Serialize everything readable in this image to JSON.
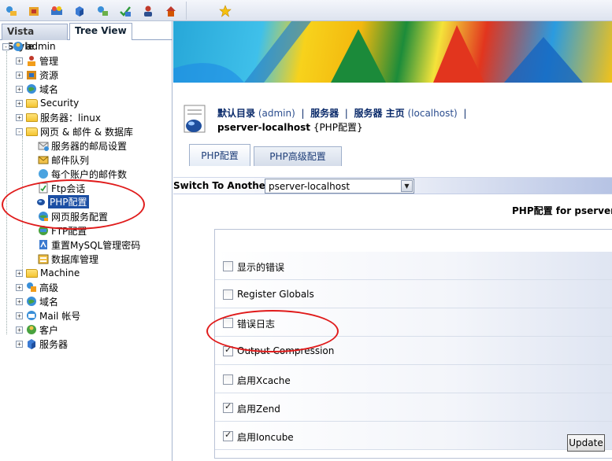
{
  "toolbar": {
    "icons": [
      "tools-icon",
      "resources-icon",
      "config-icon",
      "server-icon",
      "settings-icon",
      "check-icon",
      "user-icon",
      "home-icon",
      "favorite-star-icon"
    ]
  },
  "left_tabs": [
    {
      "label": "Vista Style",
      "active": false
    },
    {
      "label": "Tree View",
      "active": true
    }
  ],
  "tree": {
    "root": "admin",
    "items": [
      {
        "label": "管理",
        "icon": "admin-icon",
        "expander": "+"
      },
      {
        "label": "资源",
        "icon": "resource-icon",
        "expander": "+"
      },
      {
        "label": "域名",
        "icon": "globe-icon",
        "expander": "+"
      },
      {
        "label": "Security",
        "icon": "folder-icon",
        "expander": "+"
      },
      {
        "label": "服务器：linux",
        "icon": "folder-icon",
        "expander": "+"
      },
      {
        "label": "网页 & 邮件 & 数据库",
        "icon": "folder-icon",
        "expander": "-"
      },
      {
        "label": "服务器的邮局设置",
        "icon": "mail-server-icon",
        "expander": ""
      },
      {
        "label": "邮件队列",
        "icon": "mail-queue-icon",
        "expander": ""
      },
      {
        "label": "每个账户的邮件数",
        "icon": "mail-count-icon",
        "expander": ""
      },
      {
        "label": "Ftp会话",
        "icon": "ftp-session-icon",
        "expander": ""
      },
      {
        "label": "PHP配置",
        "icon": "php-icon",
        "expander": "",
        "selected": true
      },
      {
        "label": "网页服务配置",
        "icon": "web-config-icon",
        "expander": ""
      },
      {
        "label": "FTP配置",
        "icon": "ftp-config-icon",
        "expander": ""
      },
      {
        "label": "重置MySQL管理密码",
        "icon": "mysql-icon",
        "expander": ""
      },
      {
        "label": "数据库管理",
        "icon": "database-icon",
        "expander": ""
      },
      {
        "label": "Machine",
        "icon": "folder-icon",
        "expander": "+"
      },
      {
        "label": "高级",
        "icon": "advanced-icon",
        "expander": "+"
      },
      {
        "label": "域名",
        "icon": "globe-icon",
        "expander": "+"
      },
      {
        "label": "Mail 帐号",
        "icon": "mail-icon",
        "expander": "+"
      },
      {
        "label": "客户",
        "icon": "client-icon",
        "expander": "+"
      },
      {
        "label": "服务器",
        "icon": "server-icon",
        "expander": "+"
      }
    ]
  },
  "breadcrumb": {
    "part1": "默认目录",
    "part1_paren": "(admin)",
    "sep": "|",
    "part2": "服务器",
    "part3": "服务器 主页",
    "part3_paren": "(localhost)"
  },
  "page_title": {
    "bold": "pserver-localhost",
    "rest": " {PHP配置}"
  },
  "content_tabs": [
    {
      "label": "PHP配置",
      "active": true
    },
    {
      "label": "PHP高级配置",
      "active": false
    }
  ],
  "switch": {
    "label": "Switch To Another",
    "selected": "pserver-localhost"
  },
  "section_title": "PHP配置 for pserver-",
  "options": [
    {
      "label": "显示的错误",
      "checked": false
    },
    {
      "label": "Register Globals",
      "checked": false
    },
    {
      "label": "错误日志",
      "checked": false
    },
    {
      "label": "Output Compression",
      "checked": true
    },
    {
      "label": "启用Xcache",
      "checked": false
    },
    {
      "label": "启用Zend",
      "checked": true
    },
    {
      "label": "启用Ioncube",
      "checked": true
    }
  ],
  "update_label": "Update",
  "colors": {
    "accent": "#1c4fa4",
    "annotation": "#e01b1b"
  }
}
